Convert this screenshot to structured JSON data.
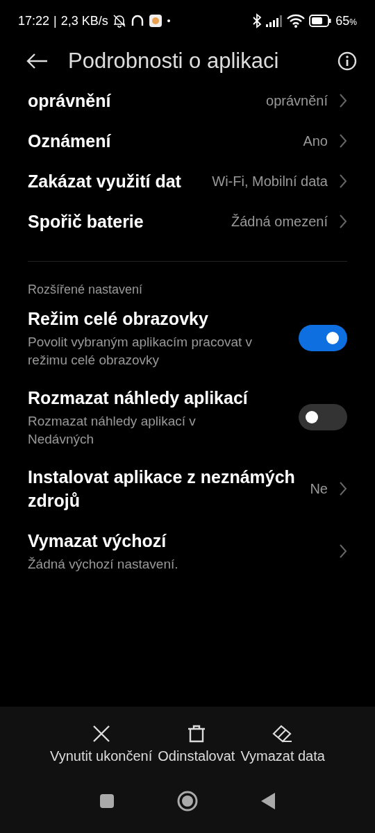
{
  "status_bar": {
    "time": "17:22",
    "separator": "|",
    "speed": "2,3 KB/s",
    "battery": "65",
    "battery_unit": "%"
  },
  "header": {
    "title": "Podrobnosti o aplikaci"
  },
  "settings": [
    {
      "kind": "link",
      "title": "oprávnění",
      "value": "oprávnění"
    },
    {
      "kind": "link",
      "title": "Oznámení",
      "value": "Ano"
    },
    {
      "kind": "link",
      "title": "Zakázat využití dat",
      "value": "Wi-Fi, Mobilní data"
    },
    {
      "kind": "link",
      "title": "Spořič baterie",
      "value": "Žádná omezení"
    }
  ],
  "advanced": {
    "heading": "Rozšířené nastavení",
    "items": [
      {
        "kind": "toggle",
        "title": "Režim celé obrazovky",
        "subtitle": "Povolit vybraným aplikacím pracovat v režimu celé obrazovky",
        "on": true
      },
      {
        "kind": "toggle",
        "title": "Rozmazat náhledy aplikací",
        "subtitle": "Rozmazat náhledy aplikací v Nedávných",
        "on": false
      },
      {
        "kind": "link",
        "title": "Instalovat aplikace z neznámých zdrojů",
        "value": "Ne"
      },
      {
        "kind": "link",
        "title": "Vymazat výchozí",
        "subtitle": "Žádná výchozí nastavení."
      }
    ]
  },
  "actions": [
    {
      "kind": "close",
      "label": "Vynutit ukončení"
    },
    {
      "kind": "trash",
      "label": "Odinstalovat"
    },
    {
      "kind": "eraser",
      "label": "Vymazat data"
    }
  ]
}
